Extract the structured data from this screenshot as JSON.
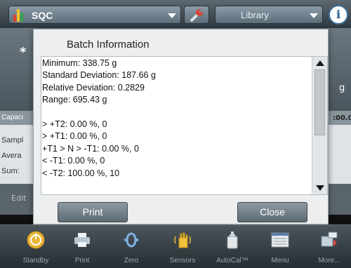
{
  "topbar": {
    "app_title": "SQC",
    "library_label": "Library",
    "info_label": "i"
  },
  "background": {
    "star": "*",
    "unit": "g",
    "capacity_label": "Capaci",
    "capacity_value": ":00.00",
    "sample_label": "Sampl",
    "average_label": "Avera",
    "sum_label": "Sum:",
    "edit_label": "Edit"
  },
  "dialog": {
    "title": "Batch Information",
    "lines": [
      "Minimum: 338.75 g",
      "Standard Deviation: 187.66 g",
      "Relative Deviation: 0.2829",
      "Range: 695.43 g",
      "",
      "> +T2: 0.00 %, 0",
      "> +T1: 0.00 %, 0",
      "+T1 > N > -T1: 0.00 %, 0",
      "< -T1: 0.00 %, 0",
      "< -T2: 100.00 %, 10"
    ],
    "print_label": "Print",
    "close_label": "Close"
  },
  "toolbar": {
    "items": [
      {
        "label": "Standby",
        "icon": "standby-icon"
      },
      {
        "label": "Print",
        "icon": "printer-icon"
      },
      {
        "label": "Zero",
        "icon": "zero-icon"
      },
      {
        "label": "Sensors",
        "icon": "sensors-hand-icon"
      },
      {
        "label": "AutoCal™",
        "icon": "autocal-weight-icon"
      },
      {
        "label": "Menu",
        "icon": "menu-icon"
      },
      {
        "label": "More...",
        "icon": "more-icon"
      }
    ]
  },
  "colors": {
    "accent_blue": "#1f5a91",
    "standby_yellow": "#e8b73a",
    "sensors_yellow": "#f0c23a"
  }
}
